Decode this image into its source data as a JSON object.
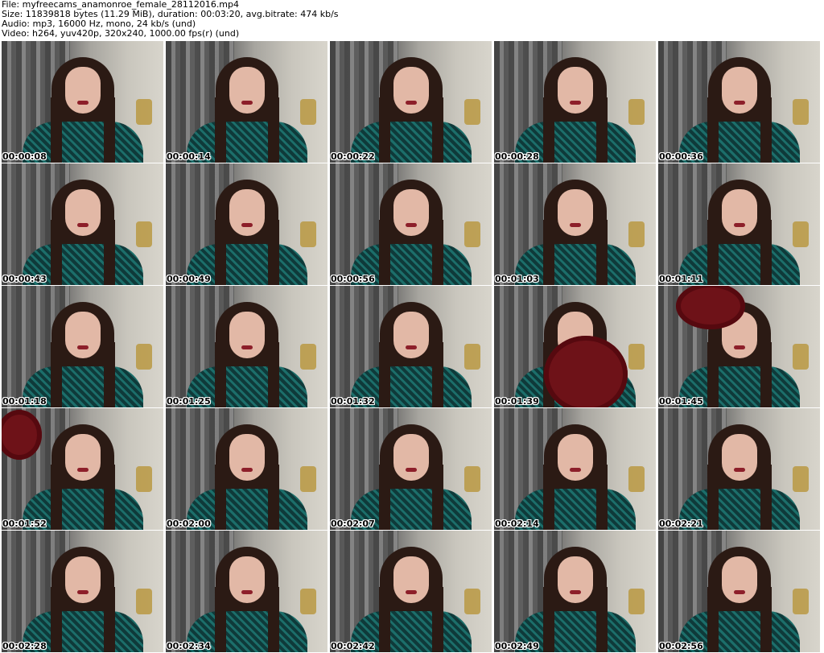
{
  "header": {
    "file": "File: myfreecams_anamonroe_female_28112016.mp4",
    "size": "Size: 11839818 bytes (11.29 MiB), duration: 00:03:20, avg.bitrate: 474 kb/s",
    "audio": "Audio: mp3, 16000 Hz, mono, 24 kb/s (und)",
    "video": "Video: h264, yuv420p, 320x240, 1000.00 fps(r) (und)"
  },
  "thumbnails": [
    {
      "time": "00:00:08"
    },
    {
      "time": "00:00:14"
    },
    {
      "time": "00:00:22"
    },
    {
      "time": "00:00:28"
    },
    {
      "time": "00:00:36"
    },
    {
      "time": "00:00:43"
    },
    {
      "time": "00:00:49"
    },
    {
      "time": "00:00:56"
    },
    {
      "time": "00:01:03"
    },
    {
      "time": "00:01:11"
    },
    {
      "time": "00:01:18"
    },
    {
      "time": "00:01:25"
    },
    {
      "time": "00:01:32"
    },
    {
      "time": "00:01:39",
      "prop": "hat-front"
    },
    {
      "time": "00:01:45",
      "prop": "hat-top"
    },
    {
      "time": "00:01:52",
      "prop": "hat-left"
    },
    {
      "time": "00:02:00"
    },
    {
      "time": "00:02:07"
    },
    {
      "time": "00:02:14"
    },
    {
      "time": "00:02:21"
    },
    {
      "time": "00:02:28"
    },
    {
      "time": "00:02:34"
    },
    {
      "time": "00:02:42"
    },
    {
      "time": "00:02:49"
    },
    {
      "time": "00:02:56"
    }
  ]
}
